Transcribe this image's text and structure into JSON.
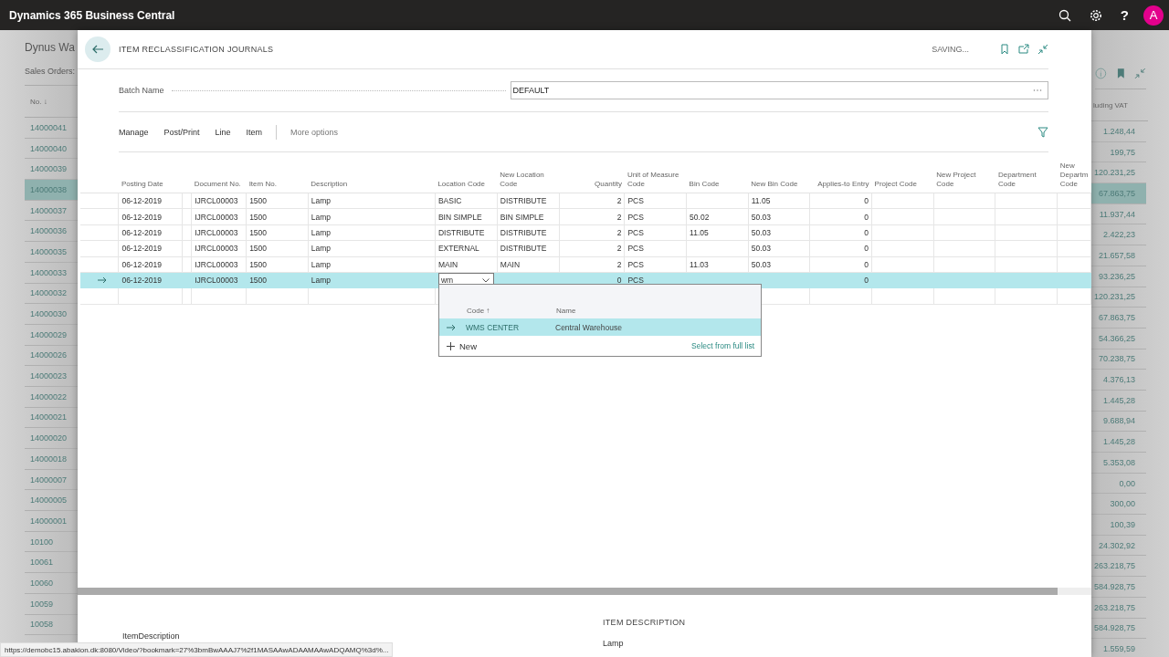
{
  "app_bar": {
    "title": "Dynamics 365 Business Central",
    "help": "?",
    "avatar": "A"
  },
  "background_page": {
    "title": "Dynus Wa",
    "subtitle": "Sales Orders:",
    "column_1": "No. ↓",
    "column_2": "luding VAT",
    "rows": [
      {
        "no": "14000041",
        "amount": "1.248,44",
        "selected": false
      },
      {
        "no": "14000040",
        "amount": "199,75",
        "selected": false
      },
      {
        "no": "14000039",
        "amount": "120.231,25",
        "selected": false
      },
      {
        "no": "14000038",
        "amount": "67.863,75",
        "selected": true
      },
      {
        "no": "14000037",
        "amount": "11.937,44",
        "selected": false
      },
      {
        "no": "14000036",
        "amount": "2.422,23",
        "selected": false
      },
      {
        "no": "14000035",
        "amount": "21.657,58",
        "selected": false
      },
      {
        "no": "14000033",
        "amount": "93.236,25",
        "selected": false
      },
      {
        "no": "14000032",
        "amount": "120.231,25",
        "selected": false
      },
      {
        "no": "14000030",
        "amount": "67.863,75",
        "selected": false
      },
      {
        "no": "14000029",
        "amount": "54.366,25",
        "selected": false
      },
      {
        "no": "14000026",
        "amount": "70.238,75",
        "selected": false
      },
      {
        "no": "14000023",
        "amount": "4.376,13",
        "selected": false
      },
      {
        "no": "14000022",
        "amount": "1.445,28",
        "selected": false
      },
      {
        "no": "14000021",
        "amount": "9.688,94",
        "selected": false
      },
      {
        "no": "14000020",
        "amount": "1.445,28",
        "selected": false
      },
      {
        "no": "14000018",
        "amount": "5.353,08",
        "selected": false
      },
      {
        "no": "14000007",
        "amount": "0,00",
        "selected": false
      },
      {
        "no": "14000005",
        "amount": "300,00",
        "selected": false
      },
      {
        "no": "14000001",
        "amount": "100,39",
        "selected": false
      },
      {
        "no": "10100",
        "amount": "24.302,92",
        "selected": false
      },
      {
        "no": "10061",
        "amount": "263.218,75",
        "selected": false
      },
      {
        "no": "10060",
        "amount": "584.928,75",
        "selected": false
      },
      {
        "no": "10059",
        "amount": "263.218,75",
        "selected": false
      },
      {
        "no": "10058",
        "amount": "584.928,75",
        "selected": false
      },
      {
        "amount": "1.559,59",
        "selected": false
      }
    ]
  },
  "panel": {
    "title": "ITEM RECLASSIFICATION JOURNALS",
    "status": "SAVING...",
    "batch": {
      "label": "Batch Name",
      "value": "DEFAULT"
    },
    "actions": [
      "Manage",
      "Post/Print",
      "Line",
      "Item"
    ],
    "more": "More options",
    "table": {
      "columns": [
        {
          "label": "Posting Date",
          "kind": "text"
        },
        {
          "label": "Document No.",
          "kind": "text"
        },
        {
          "label": "Item No.",
          "kind": "text"
        },
        {
          "label": "Description",
          "kind": "text"
        },
        {
          "label": "Location Code",
          "kind": "text"
        },
        {
          "label": "New Location Code",
          "kind": "text"
        },
        {
          "label": "Quantity",
          "kind": "number"
        },
        {
          "label": "Unit of Measure Code",
          "kind": "text"
        },
        {
          "label": "Bin Code",
          "kind": "text"
        },
        {
          "label": "New Bin Code",
          "kind": "text"
        },
        {
          "label": "Applies-to Entry",
          "kind": "number"
        },
        {
          "label": "Project Code",
          "kind": "text"
        },
        {
          "label": "New Project Code",
          "kind": "text"
        },
        {
          "label": "Department Code",
          "kind": "text"
        },
        {
          "label": "New Departm Code",
          "kind": "text"
        }
      ],
      "rows": [
        {
          "selected": false,
          "cells": [
            "06-12-2019",
            "IJRCL00003",
            "1500",
            "Lamp",
            "BASIC",
            "DISTRIBUTE",
            "2",
            "PCS",
            null,
            "11.05",
            "0",
            null,
            null,
            null,
            null
          ]
        },
        {
          "selected": false,
          "cells": [
            "06-12-2019",
            "IJRCL00003",
            "1500",
            "Lamp",
            "BIN SIMPLE",
            "BIN SIMPLE",
            "2",
            "PCS",
            "50.02",
            "50.03",
            "0",
            null,
            null,
            null,
            null
          ]
        },
        {
          "selected": false,
          "cells": [
            "06-12-2019",
            "IJRCL00003",
            "1500",
            "Lamp",
            "DISTRIBUTE",
            "DISTRIBUTE",
            "2",
            "PCS",
            "11.05",
            "50.03",
            "0",
            null,
            null,
            null,
            null
          ]
        },
        {
          "selected": false,
          "cells": [
            "06-12-2019",
            "IJRCL00003",
            "1500",
            "Lamp",
            "EXTERNAL",
            "DISTRIBUTE",
            "2",
            "PCS",
            null,
            "50.03",
            "0",
            null,
            null,
            null,
            null
          ]
        },
        {
          "selected": false,
          "cells": [
            "06-12-2019",
            "IJRCL00003",
            "1500",
            "Lamp",
            "MAIN",
            "MAIN",
            "2",
            "PCS",
            "11.03",
            "50.03",
            "0",
            null,
            null,
            null,
            null
          ]
        },
        {
          "selected": true,
          "cells": [
            "06-12-2019",
            "IJRCL00003",
            "1500",
            "Lamp",
            {
              "kind": "dropdown",
              "text": "wm"
            },
            null,
            "0",
            "PCS",
            null,
            null,
            "0",
            null,
            null,
            null,
            null
          ]
        },
        {
          "selected": false,
          "cells": [
            null,
            null,
            null,
            null,
            null,
            null,
            null,
            null,
            null,
            null,
            null,
            null,
            null,
            null,
            null
          ]
        }
      ]
    },
    "lookup": {
      "columns": [
        "Code ↑",
        "Name"
      ],
      "rows": [
        {
          "code": "WMS CENTER",
          "name": "Central Warehouse",
          "selected": true
        }
      ],
      "new": "New",
      "full_list": "Select from full list"
    },
    "fact_box": {
      "left_label": "ItemDescription",
      "title": "ITEM DESCRIPTION",
      "value": "Lamp"
    }
  },
  "status_url": "https://demobc15.abakion.dk:8080/Video/?bookmark=27%3bmBwAAAJ7%2f1MASAAwADAAMAAwADQAMQ%3d%..."
}
